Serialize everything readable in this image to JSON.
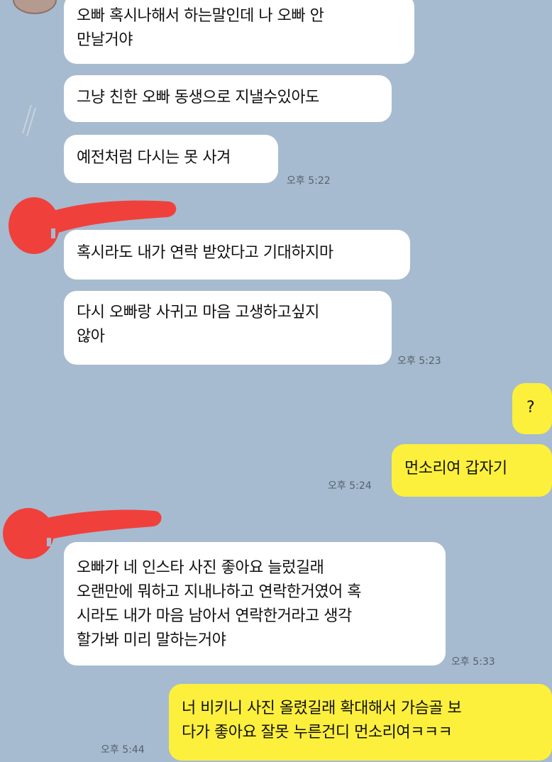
{
  "messages": [
    {
      "id": "m1",
      "side": "in",
      "text": "오빠 혹시나해서 하는말인데 나 오빠 안\n만날거야"
    },
    {
      "id": "m2",
      "side": "in",
      "text": "그냥 친한 오빠 동생으로 지낼수있아도"
    },
    {
      "id": "m3",
      "side": "in",
      "text": "예전처럼 다시는 못 사겨",
      "time": "오후 5:22"
    },
    {
      "id": "m4",
      "side": "in",
      "text": "혹시라도 내가 연락 받았다고 기대하지마"
    },
    {
      "id": "m5",
      "side": "in",
      "text": "다시 오빠랑 사귀고 마음 고생하고싶지\n않아",
      "time": "오후 5:23"
    },
    {
      "id": "m6",
      "side": "out",
      "text": "?"
    },
    {
      "id": "m7",
      "side": "out",
      "text": "먼소리여 갑자기",
      "time": "오후 5:24"
    },
    {
      "id": "m8",
      "side": "in",
      "text": "오빠가 네 인스타 사진 좋아요 늘렀길래\n오랜만에 뭐하고 지내나하고 연락한거였어 혹\n시라도 내가 마음 남아서 연락한거라고 생각\n할가봐 미리 말하는거야",
      "time": "오후 5:33"
    },
    {
      "id": "m9",
      "side": "out",
      "text": "너 비키니 사진 올렸길래 확대해서 가슴골 보\n다가 좋아요 잘못 누른건디 먼소리여ㅋㅋㅋ",
      "time": "오후 5:44"
    }
  ],
  "colors": {
    "background": "#a6bbcf",
    "incoming_bubble": "#ffffff",
    "outgoing_bubble": "#fdf03c",
    "redaction": "#f0403c"
  }
}
